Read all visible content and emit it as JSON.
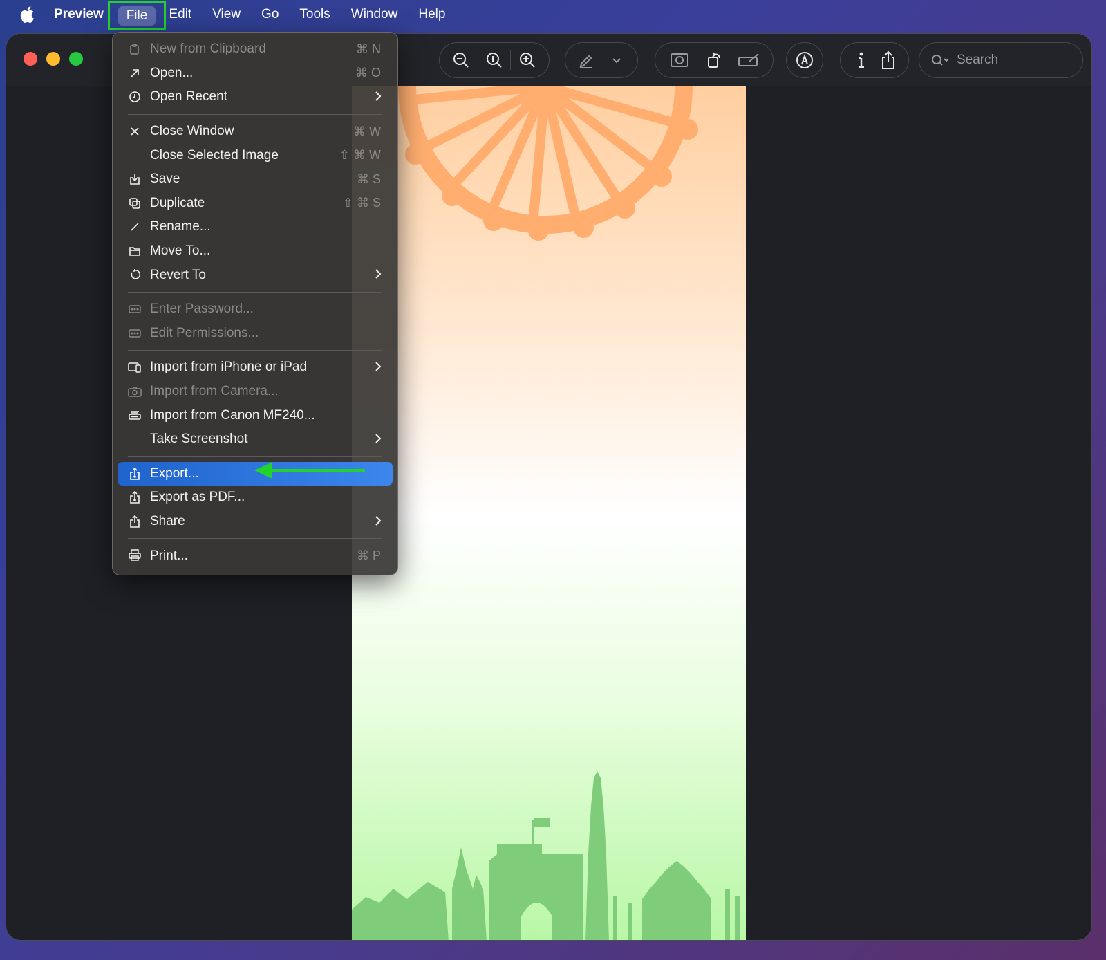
{
  "menubar": {
    "app_name": "Preview",
    "items": [
      "File",
      "Edit",
      "View",
      "Go",
      "Tools",
      "Window",
      "Help"
    ]
  },
  "toolbar": {
    "search_placeholder": "Search"
  },
  "file_menu": {
    "items": [
      {
        "label": "New from Clipboard",
        "shortcut": "⌘ N",
        "disabled": true,
        "icon": "clipboard-icon"
      },
      {
        "label": "Open...",
        "shortcut": "⌘ O",
        "icon": "open-arrow-icon"
      },
      {
        "label": "Open Recent",
        "submenu": true,
        "icon": "clock-icon"
      },
      {
        "label": "Close Window",
        "shortcut": "⌘ W",
        "icon": "close-icon"
      },
      {
        "label": "Close Selected Image",
        "shortcut": "⇧ ⌘ W",
        "icon": ""
      },
      {
        "label": "Save",
        "shortcut": "⌘ S",
        "icon": "save-icon"
      },
      {
        "label": "Duplicate",
        "shortcut": "⇧ ⌘ S",
        "icon": "duplicate-icon"
      },
      {
        "label": "Rename...",
        "icon": "pencil-icon"
      },
      {
        "label": "Move To...",
        "icon": "folder-icon"
      },
      {
        "label": "Revert To",
        "submenu": true,
        "icon": "revert-icon"
      },
      {
        "label": "Enter Password...",
        "disabled": true,
        "icon": "password-icon"
      },
      {
        "label": "Edit Permissions...",
        "disabled": true,
        "icon": "password-icon"
      },
      {
        "label": "Import from iPhone or iPad",
        "submenu": true,
        "icon": "devices-icon"
      },
      {
        "label": "Import from Camera...",
        "disabled": true,
        "icon": "camera-icon"
      },
      {
        "label": "Import from Canon MF240...",
        "icon": "scanner-icon"
      },
      {
        "label": "Take Screenshot",
        "submenu": true,
        "icon": ""
      },
      {
        "label": "Export...",
        "highlighted": true,
        "icon": "export-icon"
      },
      {
        "label": "Export as PDF...",
        "icon": "export-icon"
      },
      {
        "label": "Share",
        "submenu": true,
        "icon": "share-icon"
      },
      {
        "label": "Print...",
        "shortcut": "⌘ P",
        "icon": "printer-icon"
      }
    ]
  },
  "colors": {
    "highlight": "#2f74e0",
    "annotation": "#22d42a",
    "chakra": "#ffae70",
    "skyline": "#7fcc7a"
  }
}
